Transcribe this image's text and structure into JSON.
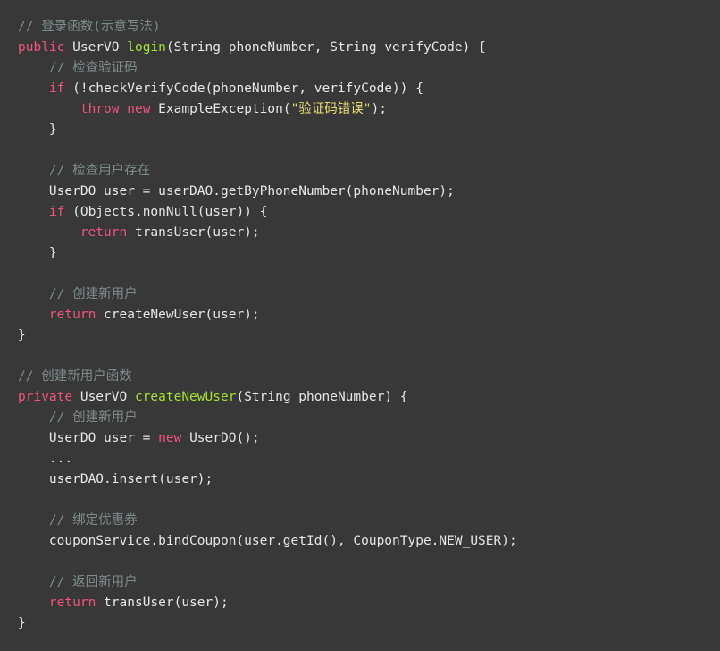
{
  "colors": {
    "background": "#383838",
    "text": "#e6e6e6",
    "comment": "#7f8c8d",
    "keyword": "#f2547d",
    "function_name": "#a6e22e",
    "string": "#e6db74"
  },
  "lines": [
    [
      {
        "t": "// 登录函数(示意写法)",
        "c": "comment"
      }
    ],
    [
      {
        "t": "public",
        "c": "keyword"
      },
      {
        "t": " UserVO ",
        "c": "plain"
      },
      {
        "t": "login",
        "c": "fn"
      },
      {
        "t": "(String phoneNumber, String verifyCode) {",
        "c": "plain"
      }
    ],
    [
      {
        "t": "    ",
        "c": "plain"
      },
      {
        "t": "// 检查验证码",
        "c": "comment"
      }
    ],
    [
      {
        "t": "    ",
        "c": "plain"
      },
      {
        "t": "if",
        "c": "keyword"
      },
      {
        "t": " (!checkVerifyCode(phoneNumber, verifyCode)) {",
        "c": "plain"
      }
    ],
    [
      {
        "t": "        ",
        "c": "plain"
      },
      {
        "t": "throw",
        "c": "keyword"
      },
      {
        "t": " ",
        "c": "plain"
      },
      {
        "t": "new",
        "c": "keyword"
      },
      {
        "t": " ExampleException(",
        "c": "plain"
      },
      {
        "t": "\"验证码错误\"",
        "c": "str"
      },
      {
        "t": ");",
        "c": "plain"
      }
    ],
    [
      {
        "t": "    }",
        "c": "plain"
      }
    ],
    [],
    [
      {
        "t": "    ",
        "c": "plain"
      },
      {
        "t": "// 检查用户存在",
        "c": "comment"
      }
    ],
    [
      {
        "t": "    UserDO user = userDAO.getByPhoneNumber(phoneNumber);",
        "c": "plain"
      }
    ],
    [
      {
        "t": "    ",
        "c": "plain"
      },
      {
        "t": "if",
        "c": "keyword"
      },
      {
        "t": " (Objects.nonNull(user)) {",
        "c": "plain"
      }
    ],
    [
      {
        "t": "        ",
        "c": "plain"
      },
      {
        "t": "return",
        "c": "keyword"
      },
      {
        "t": " transUser(user);",
        "c": "plain"
      }
    ],
    [
      {
        "t": "    }",
        "c": "plain"
      }
    ],
    [],
    [
      {
        "t": "    ",
        "c": "plain"
      },
      {
        "t": "// 创建新用户",
        "c": "comment"
      }
    ],
    [
      {
        "t": "    ",
        "c": "plain"
      },
      {
        "t": "return",
        "c": "keyword"
      },
      {
        "t": " createNewUser(user);",
        "c": "plain"
      }
    ],
    [
      {
        "t": "}",
        "c": "plain"
      }
    ],
    [],
    [
      {
        "t": "// 创建新用户函数",
        "c": "comment"
      }
    ],
    [
      {
        "t": "private",
        "c": "keyword"
      },
      {
        "t": " UserVO ",
        "c": "plain"
      },
      {
        "t": "createNewUser",
        "c": "fn"
      },
      {
        "t": "(String phoneNumber) {",
        "c": "plain"
      }
    ],
    [
      {
        "t": "    ",
        "c": "plain"
      },
      {
        "t": "// 创建新用户",
        "c": "comment"
      }
    ],
    [
      {
        "t": "    UserDO user = ",
        "c": "plain"
      },
      {
        "t": "new",
        "c": "keyword"
      },
      {
        "t": " UserDO();",
        "c": "plain"
      }
    ],
    [
      {
        "t": "    ...",
        "c": "plain"
      }
    ],
    [
      {
        "t": "    userDAO.insert(user);",
        "c": "plain"
      }
    ],
    [],
    [
      {
        "t": "    ",
        "c": "plain"
      },
      {
        "t": "// 绑定优惠券",
        "c": "comment"
      }
    ],
    [
      {
        "t": "    couponService.bindCoupon(user.getId(), CouponType.NEW_USER);",
        "c": "plain"
      }
    ],
    [],
    [
      {
        "t": "    ",
        "c": "plain"
      },
      {
        "t": "// 返回新用户",
        "c": "comment"
      }
    ],
    [
      {
        "t": "    ",
        "c": "plain"
      },
      {
        "t": "return",
        "c": "keyword"
      },
      {
        "t": " transUser(user);",
        "c": "plain"
      }
    ],
    [
      {
        "t": "}",
        "c": "plain"
      }
    ]
  ]
}
